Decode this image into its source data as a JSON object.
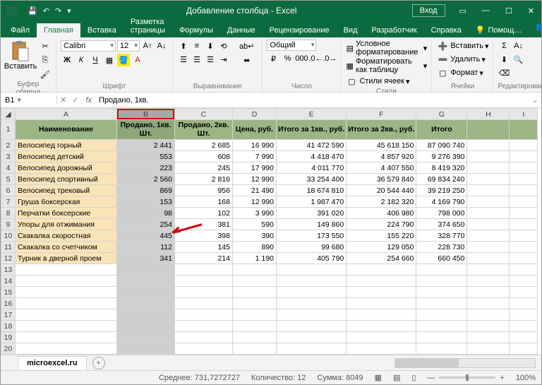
{
  "title": "Добавление столбца - Excel",
  "login": "Вход",
  "tabs": {
    "file": "Файл",
    "home": "Главная",
    "insert": "Вставка",
    "layout": "Разметка страницы",
    "formulas": "Формулы",
    "data": "Данные",
    "review": "Рецензирование",
    "view": "Вид",
    "dev": "Разработчик",
    "help": "Справка",
    "tellme": "Помощ…",
    "share": "Общий доступ"
  },
  "ribbon": {
    "clipboard": "Буфер обмена",
    "paste": "Вставить",
    "font": {
      "label": "Шрифт",
      "name": "Calibri",
      "size": "12"
    },
    "align": "Выравнивание",
    "number": {
      "label": "Число",
      "format": "Общий"
    },
    "styles": {
      "label": "Стили",
      "cond": "Условное форматирование",
      "table": "Форматировать как таблицу",
      "cell": "Стили ячеек"
    },
    "cells": {
      "label": "Ячейки",
      "insert": "Вставить",
      "delete": "Удалить",
      "format": "Формат"
    },
    "editing": "Редактирован…"
  },
  "namebox": "B1",
  "formula": "Продано, 1кв.",
  "cols": [
    "A",
    "B",
    "C",
    "D",
    "E",
    "F",
    "G",
    "H",
    "I"
  ],
  "widths": [
    20,
    144,
    82,
    82,
    62,
    72,
    72,
    72,
    60,
    40
  ],
  "headers": [
    "Наименование",
    "Продано, 1кв. Шт.",
    "Продано, 2кв. Шт.",
    "Цена, руб.",
    "Итого за 1кв., руб.",
    "Итого за 2кв., руб.",
    "Итого"
  ],
  "rows": [
    {
      "n": "Велосипед горный",
      "b": "2 441",
      "c": "2 685",
      "d": "16 990",
      "e": "41 472 590",
      "f": "45 618 150",
      "g": "87 090 740"
    },
    {
      "n": "Велосипед детский",
      "b": "553",
      "c": "608",
      "d": "7 990",
      "e": "4 418 470",
      "f": "4 857 920",
      "g": "9 276 390"
    },
    {
      "n": "Велосипед дорожный",
      "b": "223",
      "c": "245",
      "d": "17 990",
      "e": "4 011 770",
      "f": "4 407 550",
      "g": "8 419 320"
    },
    {
      "n": "Велосипед спортивный",
      "b": "2 560",
      "c": "2 816",
      "d": "12 990",
      "e": "33 254 400",
      "f": "36 579 840",
      "g": "69 834 240"
    },
    {
      "n": "Велосипед трековый",
      "b": "869",
      "c": "956",
      "d": "21 490",
      "e": "18 674 810",
      "f": "20 544 440",
      "g": "39 219 250"
    },
    {
      "n": "Груша боксерская",
      "b": "153",
      "c": "168",
      "d": "12 990",
      "e": "1 987 470",
      "f": "2 182 320",
      "g": "4 169 790"
    },
    {
      "n": "Перчатки боксерские",
      "b": "98",
      "c": "102",
      "d": "3 990",
      "e": "391 020",
      "f": "406 980",
      "g": "798 000"
    },
    {
      "n": "Упоры для отжимания",
      "b": "254",
      "c": "381",
      "d": "590",
      "e": "149 860",
      "f": "224 790",
      "g": "374 650"
    },
    {
      "n": "Скакалка скоростная",
      "b": "445",
      "c": "398",
      "d": "390",
      "e": "173 550",
      "f": "155 220",
      "g": "328 770"
    },
    {
      "n": "Скакалка со счетчиком",
      "b": "112",
      "c": "145",
      "d": "890",
      "e": "99 680",
      "f": "129 050",
      "g": "228 730"
    },
    {
      "n": "Турник в дверной проем",
      "b": "341",
      "c": "214",
      "d": "1 190",
      "e": "405 790",
      "f": "254 660",
      "g": "660 450"
    }
  ],
  "sheettab": "microexcel.ru",
  "status": {
    "avg": "Среднее: 731,7272727",
    "count": "Количество: 12",
    "sum": "Сумма: 8049",
    "zoom": "100%"
  },
  "chart_data": {
    "type": "table",
    "columns": [
      "Наименование",
      "Продано, 1кв. Шт.",
      "Продано, 2кв. Шт.",
      "Цена, руб.",
      "Итого за 1кв., руб.",
      "Итого за 2кв., руб.",
      "Итого"
    ],
    "data": [
      [
        "Велосипед горный",
        2441,
        2685,
        16990,
        41472590,
        45618150,
        87090740
      ],
      [
        "Велосипед детский",
        553,
        608,
        7990,
        4418470,
        4857920,
        9276390
      ],
      [
        "Велосипед дорожный",
        223,
        245,
        17990,
        4011770,
        4407550,
        8419320
      ],
      [
        "Велосипед спортивный",
        2560,
        2816,
        12990,
        33254400,
        36579840,
        69834240
      ],
      [
        "Велосипед трековый",
        869,
        956,
        21490,
        18674810,
        20544440,
        39219250
      ],
      [
        "Груша боксерская",
        153,
        168,
        12990,
        1987470,
        2182320,
        4169790
      ],
      [
        "Перчатки боксерские",
        98,
        102,
        3990,
        391020,
        406980,
        798000
      ],
      [
        "Упоры для отжимания",
        254,
        381,
        590,
        149860,
        224790,
        374650
      ],
      [
        "Скакалка скоростная",
        445,
        398,
        390,
        173550,
        155220,
        328770
      ],
      [
        "Скакалка со счетчиком",
        112,
        145,
        890,
        99680,
        129050,
        228730
      ],
      [
        "Турник в дверной проем",
        341,
        214,
        1190,
        405790,
        254660,
        660450
      ]
    ]
  }
}
